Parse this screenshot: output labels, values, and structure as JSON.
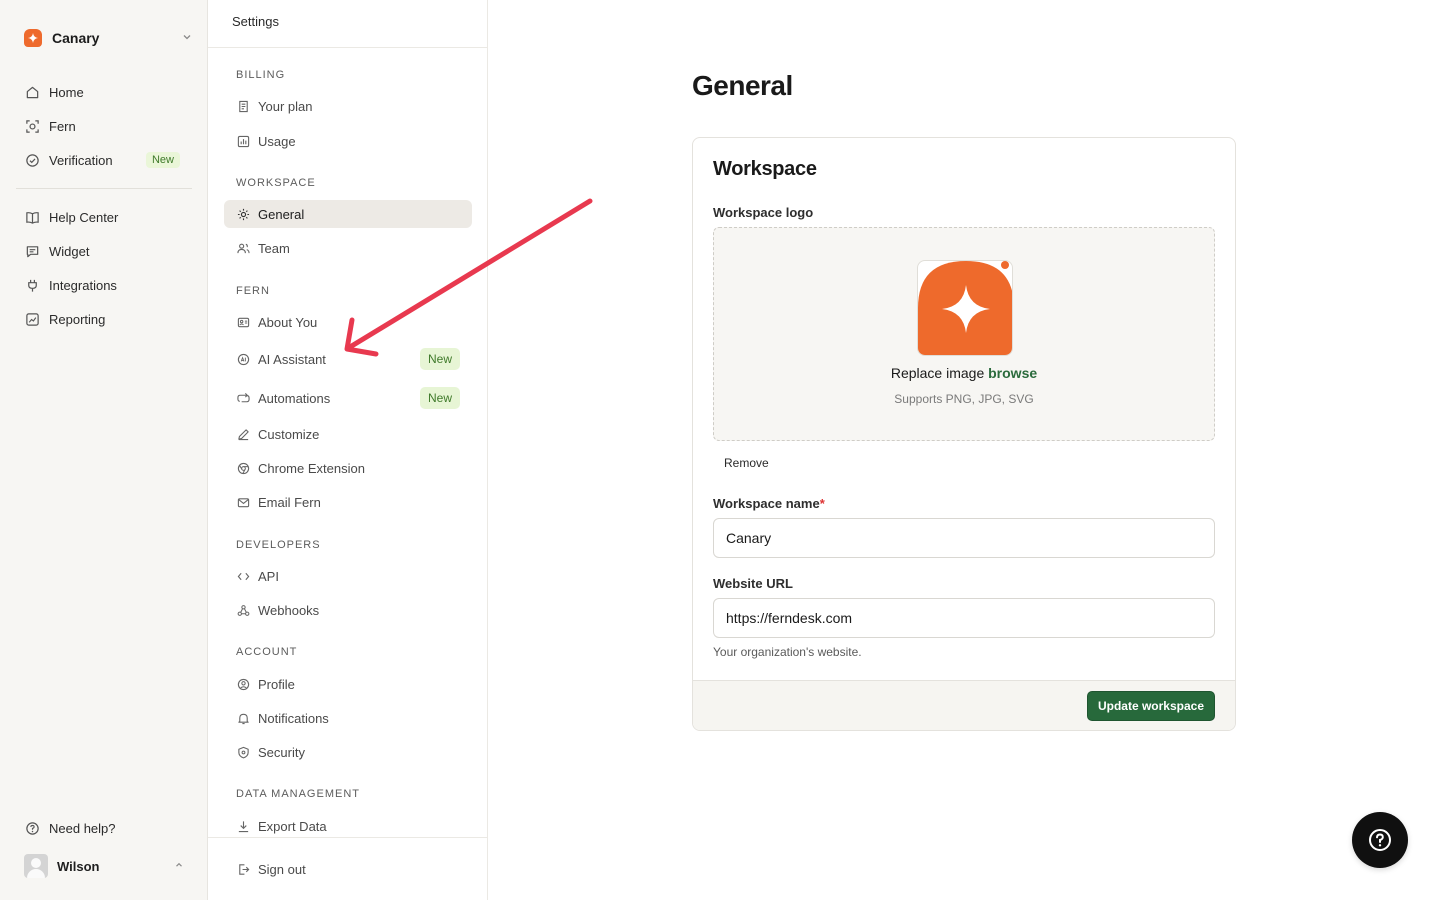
{
  "workspace_switcher": {
    "name": "Canary"
  },
  "primary_nav": {
    "items": [
      {
        "label": "Home"
      },
      {
        "label": "Fern"
      },
      {
        "label": "Verification",
        "badge": "New"
      },
      {
        "label": "Help Center"
      },
      {
        "label": "Widget"
      },
      {
        "label": "Integrations"
      },
      {
        "label": "Reporting"
      }
    ],
    "need_help": "Need help?",
    "user": "Wilson"
  },
  "settings_nav": {
    "title": "Settings",
    "sections": {
      "billing": "BILLING",
      "workspace": "WORKSPACE",
      "fern": "FERN",
      "developers": "DEVELOPERS",
      "account": "ACCOUNT",
      "data_management": "DATA MANAGEMENT"
    },
    "items": {
      "your_plan": "Your plan",
      "usage": "Usage",
      "general": "General",
      "team": "Team",
      "about_you": "About You",
      "ai_assistant": "AI Assistant",
      "automations": "Automations",
      "customize": "Customize",
      "chrome_extension": "Chrome Extension",
      "email_fern": "Email Fern",
      "api": "API",
      "webhooks": "Webhooks",
      "profile": "Profile",
      "notifications": "Notifications",
      "security": "Security",
      "export_data": "Export Data",
      "sign_out": "Sign out"
    },
    "new_badge": "New"
  },
  "main": {
    "page_title": "General",
    "card": {
      "title": "Workspace",
      "logo_label": "Workspace logo",
      "replace_text": "Replace image",
      "browse_text": "browse",
      "supports_text": "Supports PNG, JPG, SVG",
      "remove_label": "Remove",
      "name_label": "Workspace name",
      "name_required": "*",
      "name_value": "Canary",
      "url_label": "Website URL",
      "url_value": "https://ferndesk.com",
      "url_help": "Your organization's website.",
      "submit_label": "Update workspace"
    }
  },
  "colors": {
    "brand": "#ee6a2c",
    "primary_button": "#27693b",
    "badge_bg": "#e7f5d5",
    "badge_text": "#3f7a2a",
    "annotation_arrow": "#e8394f"
  },
  "icons": {
    "help_fab": "question-circle-icon"
  }
}
